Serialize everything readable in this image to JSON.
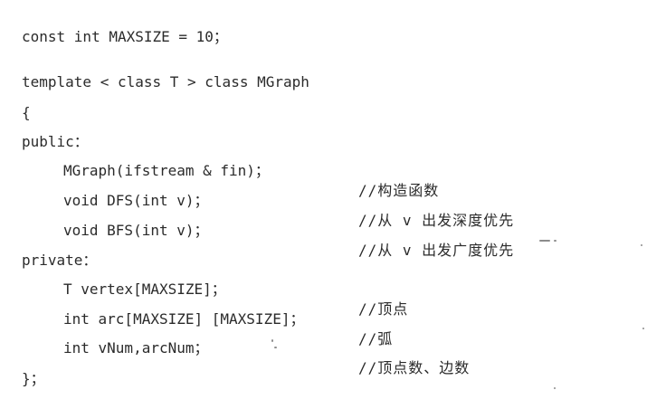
{
  "lines": [
    {
      "code": "const int MAXSIZE = 10；"
    },
    {
      "code": ""
    },
    {
      "code": "template < class T > class MGraph"
    },
    {
      "code": "{"
    },
    {
      "code": "public："
    },
    {
      "code": "MGraph(ifstream & fin)；",
      "comment": "//构造函数"
    },
    {
      "code": "void DFS(int v)；",
      "comment": "//从 v 出发深度优先"
    },
    {
      "code": "void BFS(int v)；",
      "comment": "//从 v 出发广度优先"
    },
    {
      "code": "private："
    },
    {
      "code": "T vertex[MAXSIZE]；",
      "comment": "//顶点"
    },
    {
      "code": "int arc[MAXSIZE] [MAXSIZE]；",
      "comment": "//弧"
    },
    {
      "code": "int vNum,arcNum；",
      "comment": "//顶点数、边数"
    },
    {
      "code": "}；"
    }
  ]
}
